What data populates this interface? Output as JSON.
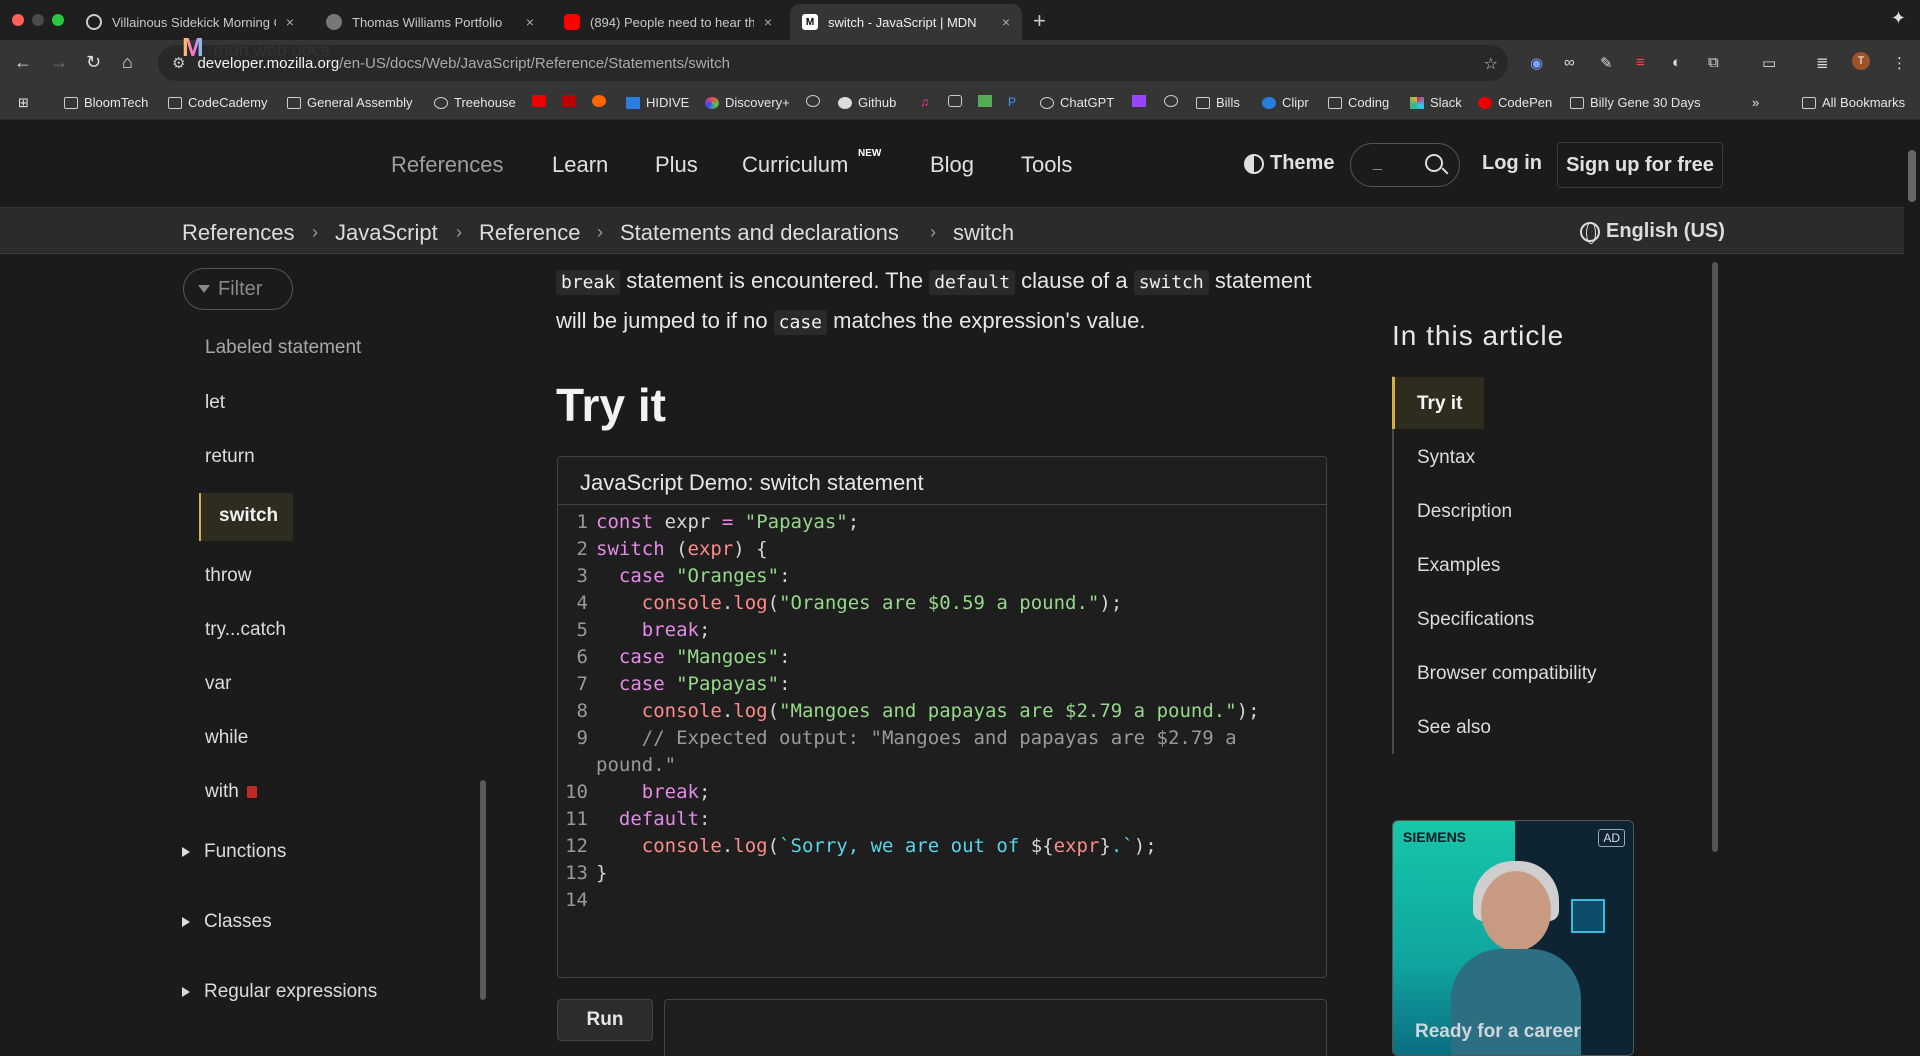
{
  "browser": {
    "tabs": [
      {
        "title": "Villainous Sidekick Morning C",
        "close": "×"
      },
      {
        "title": "Thomas Williams Portfolio",
        "close": "×"
      },
      {
        "title": "(894) People need to hear thi",
        "close": "×"
      },
      {
        "title": "switch - JavaScript | MDN",
        "close": "×"
      }
    ],
    "new_tab": "+",
    "url_host": "developer.mozilla.org",
    "url_path": "/en-US/docs/Web/JavaScript/Reference/Statements/switch",
    "bookmarks": [
      "BloomTech",
      "CodeCademy",
      "General Assembly",
      "Treehouse",
      "HIDIVE",
      "Discovery+",
      "Github",
      "ChatGPT",
      "Bills",
      "Clipr",
      "Coding",
      "Slack",
      "CodePen",
      "Billy Gene 30 Days",
      "All Bookmarks"
    ],
    "bookmark_more": "»",
    "avatar_letter": "T"
  },
  "header": {
    "logo": "M",
    "logo_text": "mdn web docs",
    "nav": [
      "References",
      "Learn",
      "Plus",
      "Curriculum",
      "Blog",
      "Tools"
    ],
    "new_badge": "NEW",
    "theme": "Theme",
    "search_placeholder": "_",
    "login": "Log in",
    "signup": "Sign up for free"
  },
  "breadcrumbs": [
    "References",
    "JavaScript",
    "Reference",
    "Statements and declarations",
    "switch"
  ],
  "breadcrumb_sep": "›",
  "language": "English (US)",
  "sidebar": {
    "filter_placeholder": "Filter",
    "items": [
      "Labeled statement",
      "let",
      "return",
      "switch",
      "throw",
      "try...catch",
      "var",
      "while",
      "with"
    ],
    "groups": [
      "Functions",
      "Classes",
      "Regular expressions"
    ]
  },
  "content": {
    "intro_code_break": "break",
    "intro_text_1": " statement is encountered. The ",
    "intro_code_default": "default",
    "intro_text_2": " clause of a ",
    "intro_code_switch": "switch",
    "intro_text_3": " statement will be jumped to if no ",
    "intro_code_case": "case",
    "intro_text_4": " matches the expression's value.",
    "try_heading": "Try it",
    "demo_title": "JavaScript Demo: switch statement",
    "run_label": "Run"
  },
  "toc": {
    "title": "In this article",
    "items": [
      "Try it",
      "Syntax",
      "Description",
      "Examples",
      "Specifications",
      "Browser compatibility",
      "See also"
    ]
  },
  "ad": {
    "brand": "SIEMENS",
    "badge": "AD",
    "text": "Ready for a career"
  }
}
